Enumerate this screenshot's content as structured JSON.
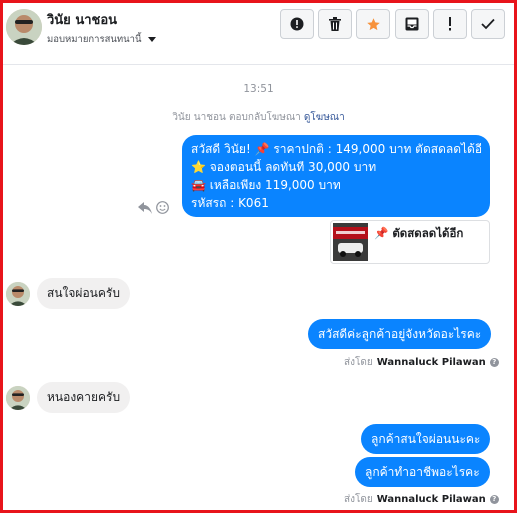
{
  "header": {
    "contact_name": "วินัย นาชอน",
    "assign_label": "มอบหมายการสนทนานี้",
    "toolbar": {
      "spam_icon": "exclamation-circle-icon",
      "delete_icon": "trash-icon",
      "star_icon": "star-icon",
      "archive_icon": "archive-icon",
      "unread_icon": "exclamation-icon",
      "done_icon": "check-icon"
    }
  },
  "thread": {
    "timestamp": "13:51",
    "ad_reply_prefix": "วินัย นาชอน ตอบกลับโฆษณา",
    "ad_reply_link": "ดูโฆษณา",
    "messages": [
      {
        "direction": "outgoing",
        "lines": [
          {
            "text": "สวัสดี วินัย! 📌 ราคาปกติ : 149,000 บาท ตัดสดลดได้อีก"
          },
          {
            "text": "⭐ จองตอนนี้ ลดทันที 30,000 บาท"
          },
          {
            "text": "🚘 เหลือเพียง 119,000 บาท"
          },
          {
            "text": "รหัสรถ : K061"
          }
        ]
      },
      {
        "direction": "outgoing-card",
        "card_text": "📌 ตัดสดลดได้อีก"
      },
      {
        "direction": "incoming",
        "text": "สนใจผ่อนครับ"
      },
      {
        "direction": "outgoing",
        "text": "สวัสดีค่ะลูกค้าอยู่จังหวัดอะไรคะ"
      },
      {
        "direction": "incoming",
        "text": "หนองคายครับ"
      },
      {
        "direction": "outgoing",
        "text": "ลูกค้าสนใจผ่อนนะคะ"
      },
      {
        "direction": "outgoing",
        "text": "ลูกค้าทำอาชีพอะไรคะ"
      }
    ],
    "sent_by_prefix": "ส่งโดย",
    "sent_by_name": "Wannaluck Pilawan",
    "help_mark": "?"
  },
  "colors": {
    "outgoing_bubble": "#0a84ff",
    "incoming_bubble": "#f1f0f0",
    "frame_border": "#e8141b",
    "star_active": "#f7923b"
  }
}
